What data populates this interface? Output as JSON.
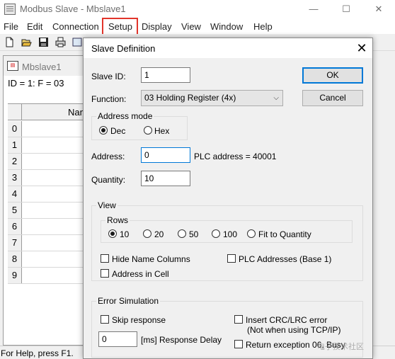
{
  "window": {
    "title": "Modbus Slave - Mbslave1",
    "minimize": "—",
    "maximize": "☐",
    "close": "✕"
  },
  "menu": {
    "items": [
      "File",
      "Edit",
      "Connection",
      "Setup",
      "Display",
      "View",
      "Window",
      "Help"
    ],
    "highlighted": "Setup",
    "highlight_color": "#e2352b"
  },
  "toolbar": {
    "icons": [
      "new-icon",
      "open-icon",
      "save-icon",
      "print-icon"
    ]
  },
  "child_window": {
    "title": "Mbslave1",
    "id_line": "ID = 1: F = 03",
    "column_header": "Nan",
    "row_numbers": [
      "0",
      "1",
      "2",
      "3",
      "4",
      "5",
      "6",
      "7",
      "8",
      "9"
    ]
  },
  "status_bar": {
    "text": "For Help, press F1."
  },
  "dialog": {
    "title": "Slave Definition",
    "close": "✕",
    "slave_id_label": "Slave ID:",
    "slave_id_value": "1",
    "function_label": "Function:",
    "function_value": "03 Holding Register (4x)",
    "ok_label": "OK",
    "cancel_label": "Cancel",
    "address_mode": {
      "title": "Address mode",
      "dec_label": "Dec",
      "hex_label": "Hex",
      "selected": "Dec"
    },
    "address_label": "Address:",
    "address_value": "0",
    "plc_address_text": "PLC address = 40001",
    "quantity_label": "Quantity:",
    "quantity_value": "10",
    "view": {
      "title": "View",
      "rows_title": "Rows",
      "rows_options": [
        "10",
        "20",
        "50",
        "100",
        "Fit to Quantity"
      ],
      "rows_selected": "10",
      "hide_name_columns": "Hide Name Columns",
      "plc_addresses": "PLC Addresses (Base 1)",
      "address_in_cell": "Address in Cell"
    },
    "error_simulation": {
      "title": "Error Simulation",
      "skip_response": "Skip response",
      "insert_crc_error": "Insert CRC/LRC error",
      "insert_crc_note": "(Not when using TCP/IP)",
      "delay_value": "0",
      "delay_label": "[ms] Response Delay",
      "return_exception": "Return exception 06, Busy"
    }
  },
  "watermark": "电子技术社区"
}
